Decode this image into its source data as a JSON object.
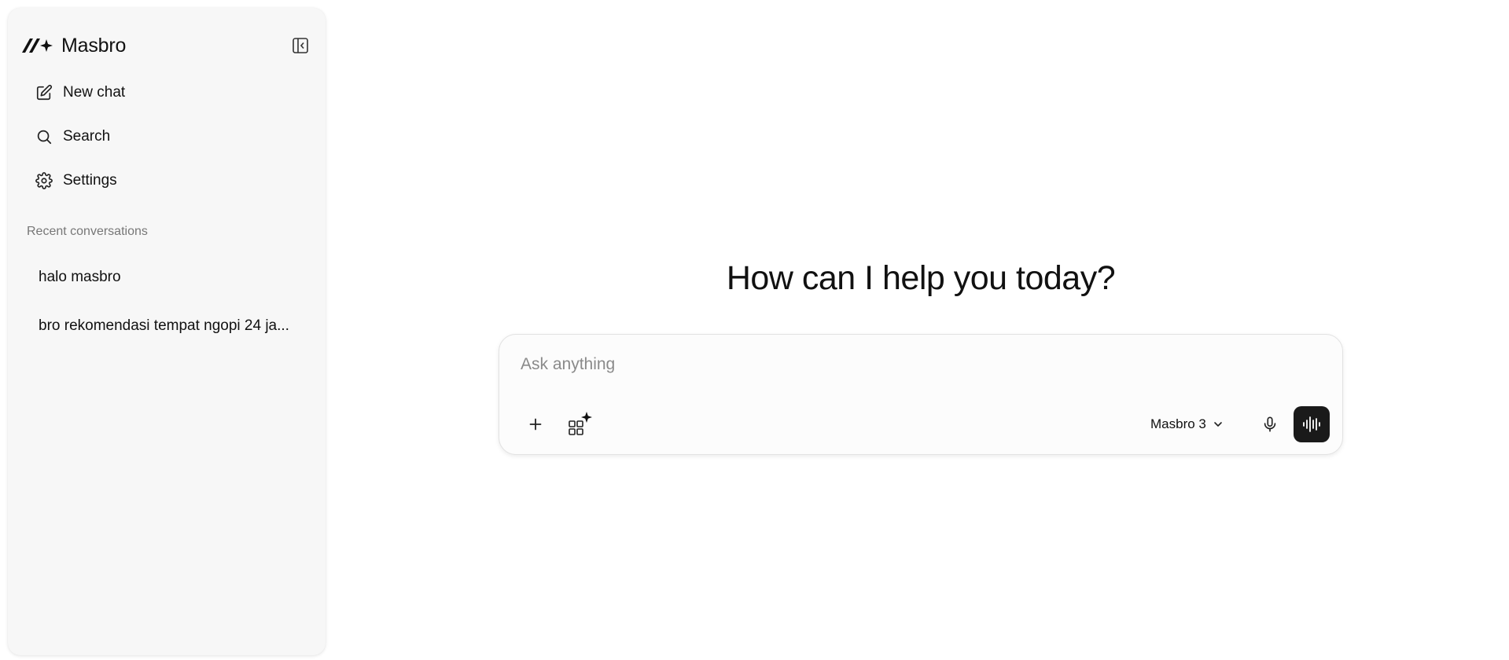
{
  "sidebar": {
    "brand": {
      "name": "Masbro",
      "logo_icon": "masbro-logo-icon"
    },
    "collapse_icon": "sidebar-collapse-icon",
    "nav": [
      {
        "label": "New chat",
        "icon": "edit-icon"
      },
      {
        "label": "Search",
        "icon": "search-icon"
      },
      {
        "label": "Settings",
        "icon": "gear-icon"
      }
    ],
    "recent_label": "Recent conversations",
    "conversations": [
      {
        "title": "halo masbro"
      },
      {
        "title": "bro rekomendasi tempat ngopi 24 ja..."
      }
    ]
  },
  "main": {
    "headline": "How can I help you today?",
    "composer": {
      "placeholder": "Ask anything",
      "value": "",
      "add_icon": "plus-icon",
      "tools_icon": "apps-sparkle-icon",
      "model": "Masbro 3",
      "model_chevron_icon": "chevron-down-icon",
      "mic_icon": "microphone-icon",
      "voice_icon": "voice-waveform-icon"
    }
  },
  "colors": {
    "sidebar_bg": "#f7f7f7",
    "page_bg": "#ffffff",
    "voice_button_bg": "#1a1a1a",
    "text_primary": "#111111",
    "text_muted": "#777777"
  }
}
